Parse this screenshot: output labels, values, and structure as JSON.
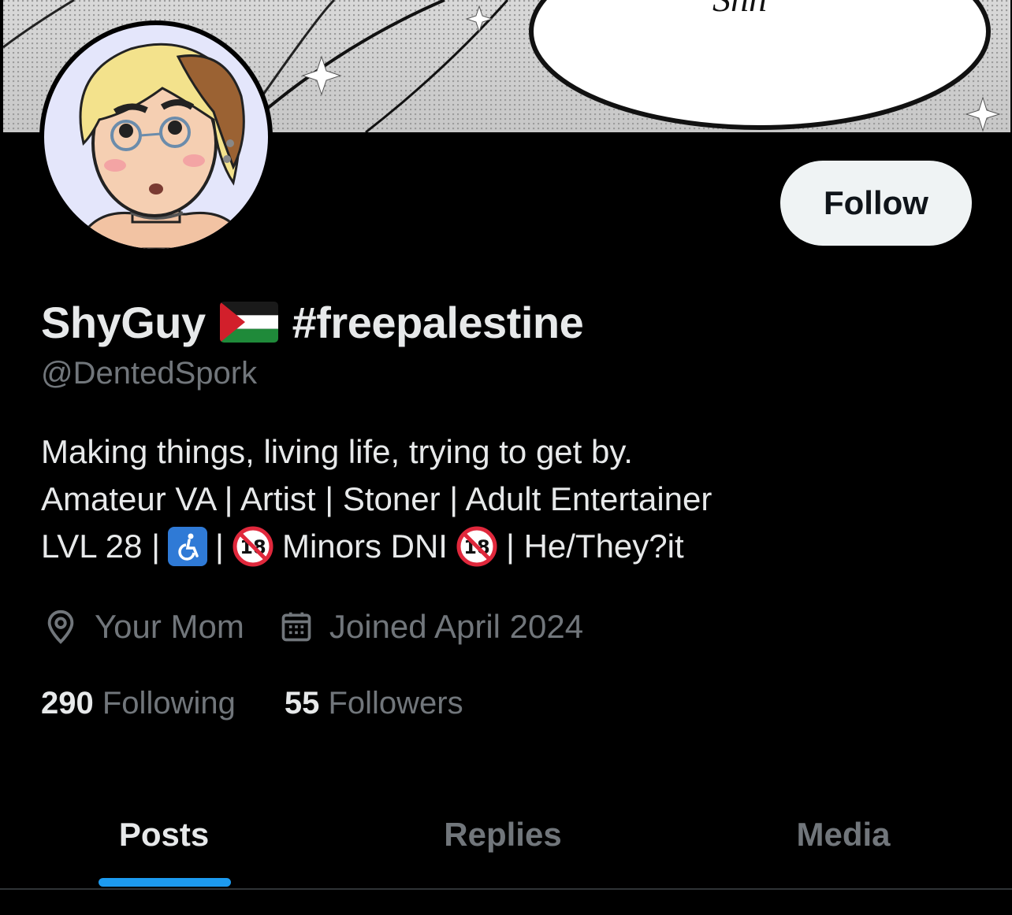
{
  "banner": {
    "speech_text": "Shh"
  },
  "profile": {
    "name_prefix": "ShyGuy",
    "flag_emoji": "palestine-flag",
    "name_suffix": "#freepalestine",
    "handle": "@DentedSpork"
  },
  "follow_button": {
    "label": "Follow"
  },
  "bio": {
    "line1": "Making things, living life, trying to get by.",
    "line2": "Amateur VA | Artist | Stoner | Adult Entertainer",
    "line3_a": "LVL 28 |",
    "line3_b": "|",
    "line3_c": "Minors DNI",
    "line3_d": "| He/They?it"
  },
  "meta": {
    "location": "Your Mom",
    "joined": "Joined April 2024"
  },
  "stats": {
    "following_count": "290",
    "following_label": "Following",
    "followers_count": "55",
    "followers_label": "Followers"
  },
  "tabs": [
    {
      "label": "Posts"
    },
    {
      "label": "Replies"
    },
    {
      "label": "Media"
    }
  ],
  "colors": {
    "accent": "#1d9bf0",
    "muted": "#71767b",
    "text": "#e7e9ea",
    "background": "#000000"
  }
}
